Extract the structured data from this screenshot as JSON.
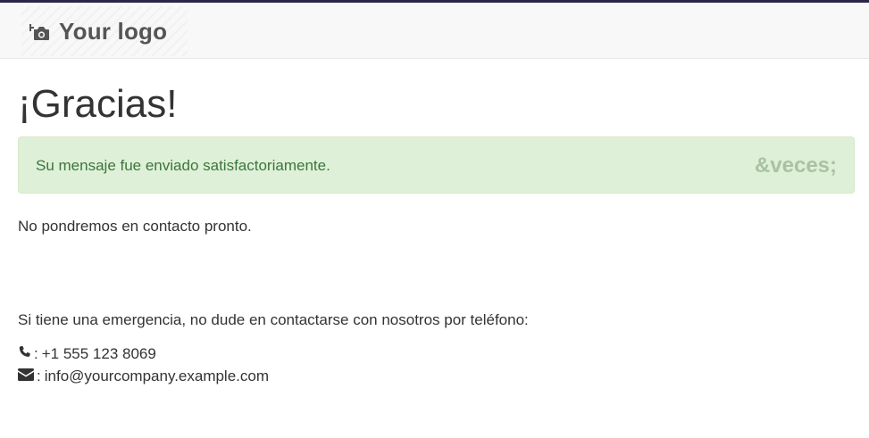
{
  "header": {
    "logo_text": "Your logo",
    "logo_icon": "camera-plus-icon"
  },
  "main": {
    "title": "¡Gracias!",
    "alert": {
      "message": "Su mensaje fue enviado satisfactoriamente.",
      "close_label": "&veces;"
    },
    "followup": "No pondremos en contacto pronto.",
    "emergency": "Si tiene una emergencia, no dude en contactarse con nosotros por teléfono:",
    "contact": {
      "phone_icon": "phone-icon",
      "separator": ":",
      "phone": "+1 555 123 8069",
      "email_icon": "envelope-icon",
      "email": "info@yourcompany.example.com"
    }
  },
  "colors": {
    "alert_bg": "#dff0d8",
    "alert_text": "#3c763d",
    "header_bg": "#f8f8f8",
    "top_rule": "#2a2746"
  }
}
